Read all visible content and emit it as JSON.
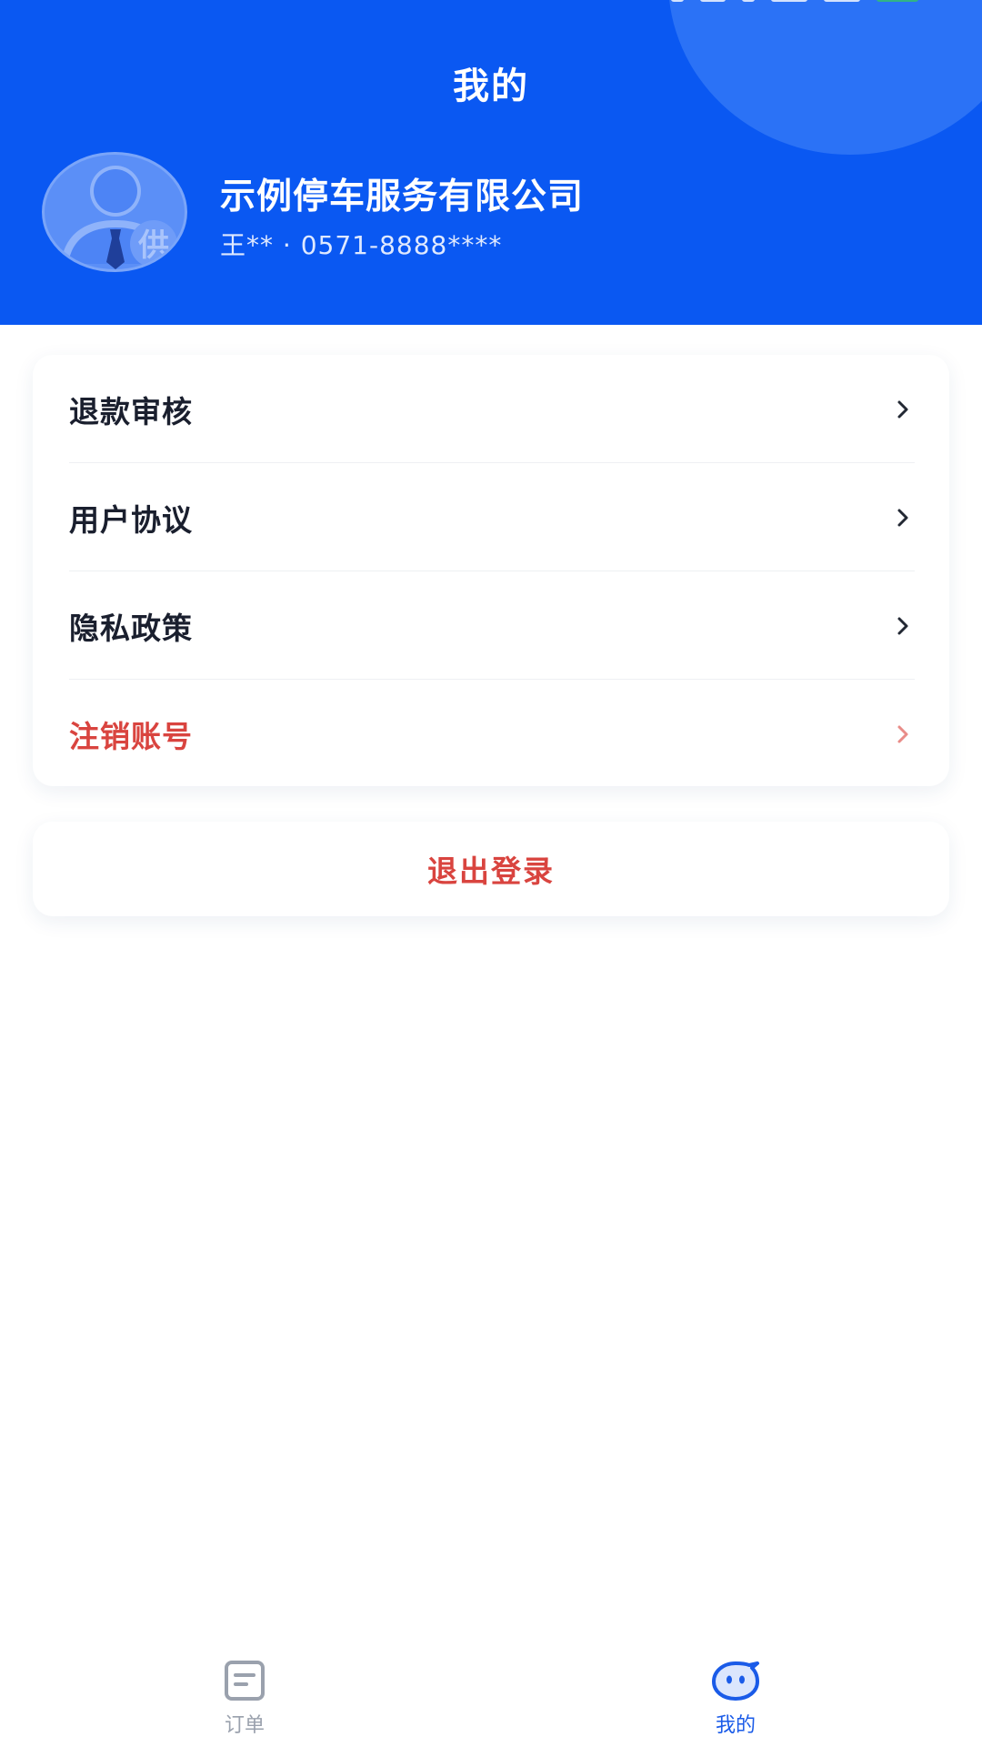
{
  "header": {
    "title": "我的",
    "company_name": "示例停车服务有限公司",
    "contact": "王** · 0571-8888****",
    "avatar_icon": "business-user-avatar-icon",
    "avatar_badge": "供"
  },
  "menu": {
    "items": [
      {
        "label": "退款审核",
        "icon": "chevron-right-icon",
        "style": "normal"
      },
      {
        "label": "用户协议",
        "icon": "chevron-right-icon",
        "style": "normal"
      },
      {
        "label": "隐私政策",
        "icon": "chevron-right-icon",
        "style": "normal"
      },
      {
        "label": "注销账号",
        "icon": "chevron-right-icon",
        "style": "danger"
      }
    ]
  },
  "logout": {
    "label": "退出登录"
  },
  "tabbar": {
    "tabs": [
      {
        "label": "订单",
        "icon": "orders-icon",
        "active": false
      },
      {
        "label": "我的",
        "icon": "smiley-icon",
        "active": true
      }
    ]
  },
  "colors": {
    "brand": "#0a58f2",
    "danger": "#d9443f",
    "text": "#1a1f2e",
    "tab_active": "#1a5be8",
    "tab_inactive": "#9aa1ad"
  }
}
